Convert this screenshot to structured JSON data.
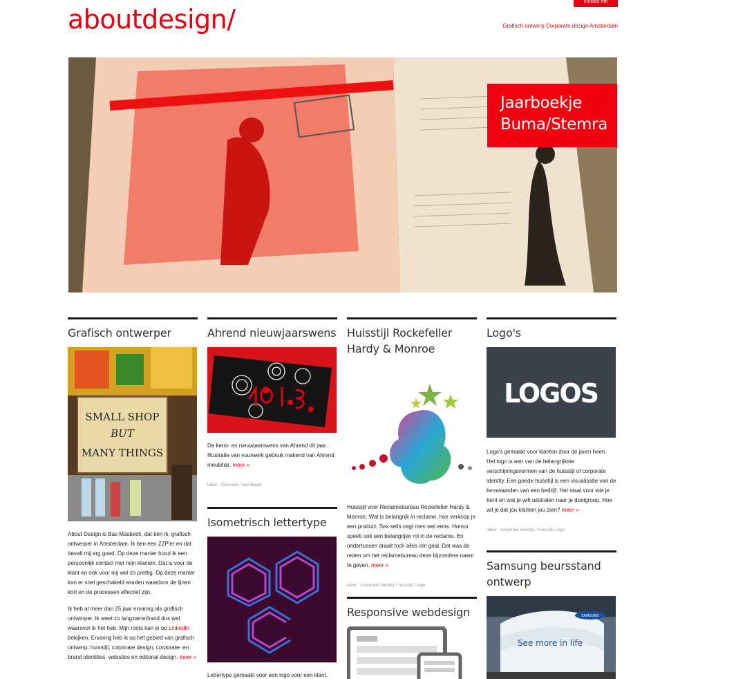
{
  "header": {
    "logo": "aboutdesign/",
    "contact_label": "contact me",
    "tagline": "Grafisch ontwerp Corporate design Amsterdam"
  },
  "hero": {
    "caption_line1": "Jaarboekje",
    "caption_line2": "Buma/Stemra"
  },
  "columns": {
    "c1": {
      "title": "Grafisch ontwerper",
      "sign_line1": "SMALL SHOP",
      "sign_line2": "BUT",
      "sign_line3": "MANY THINGS",
      "p1": "About Design is Bas Masbeck, dat ben ik, grafisch ontwerper in Amsterdam. Ik ben een ZZP'er en dat bevalt mij erg goed. Op deze manier houd ik een persoonlijk contact met mijn klanten. Dat is voor de klant en ook voor mij wel zo prettig. Op deze manier kan er snel geschakeld worden waardoor de lijnen kort en de processen effectief zijn.",
      "p2_before": "Ik heb al meer dan 25 jaar ervaring als grafisch ontwerper. Ik weet zo langzamerhand dus wel waarover ik het heb. Mijn roots kan je op ",
      "p2_link": "LinkedIn",
      "p2_after": " bekijken. Ervaring heb ik op het gebied van grafisch ontwerp, huisstijl, corporate design, corporate- en brand identities, websites en editorial design.",
      "more": "meer »"
    },
    "c2a": {
      "title": "Ahrend nieuwjaarswens",
      "text": "De kerst- en nieuwjaarswens van Ahrend dit jaar. Illustratie van vuurwerk gebruik makend van Ahrend meubilair.",
      "more": "meer »",
      "label_prefix": "label:",
      "tag1": "illustratie",
      "sep": "/",
      "tag2": "kerstkaart"
    },
    "c2b": {
      "title": "Isometrisch lettertype",
      "text": "Lettertype gemaakt voor een logo voor een klant."
    },
    "c3a": {
      "title_line1": "Huisstijl Rockefeller",
      "title_line2": "Hardy & Monroe",
      "text": "Huisstijl voor Reclamebureau Rockefeller Hardy & Monroe. Wat is belangrijk in reclame, hoe verkoop je een product. Sex sells zegt men wel eens. Humor speelt ook een belangrijke rol in de reclame. En ondertussen draait toch alles om geld. Dat was de reden om het reclamebureau deze bijzondere naam te geven.",
      "more": "meer »",
      "label_prefix": "label:",
      "tag1": "corporate identity",
      "sep1": "/",
      "tag2": "huisstijl",
      "sep2": "/",
      "tag3": "logo"
    },
    "c3b": {
      "title": "Responsive webdesign"
    },
    "c4a": {
      "title": "Logo's",
      "thumb_text": "LOGOS",
      "text": "Logo's gemaakt voor klanten door de jaren heen. Het logo is een van de belangrijkste verschijningsvormen van de huisstijl of corporate identity. Een goede huisstijl is een visualisatie van de kernwaarden van een bedrijf. Het staat voor wie je bent en wat je wilt uitstralen naar je doelgroep. Hoe wil je dat jou klanten jou zien?",
      "more": "meer »",
      "label_prefix": "label:",
      "tag1": "corporate identity",
      "sep1": "/",
      "tag2": "huisstijl",
      "sep2": "/",
      "tag3": "logo"
    },
    "c4b": {
      "title_line1": "Samsung beursstand",
      "title_line2": "ontwerp",
      "booth_text": "See more in life",
      "booth_brand": "SAMSUNG"
    }
  },
  "colors": {
    "accent": "#e4000f",
    "heading_rule": "#1a1a1a"
  }
}
